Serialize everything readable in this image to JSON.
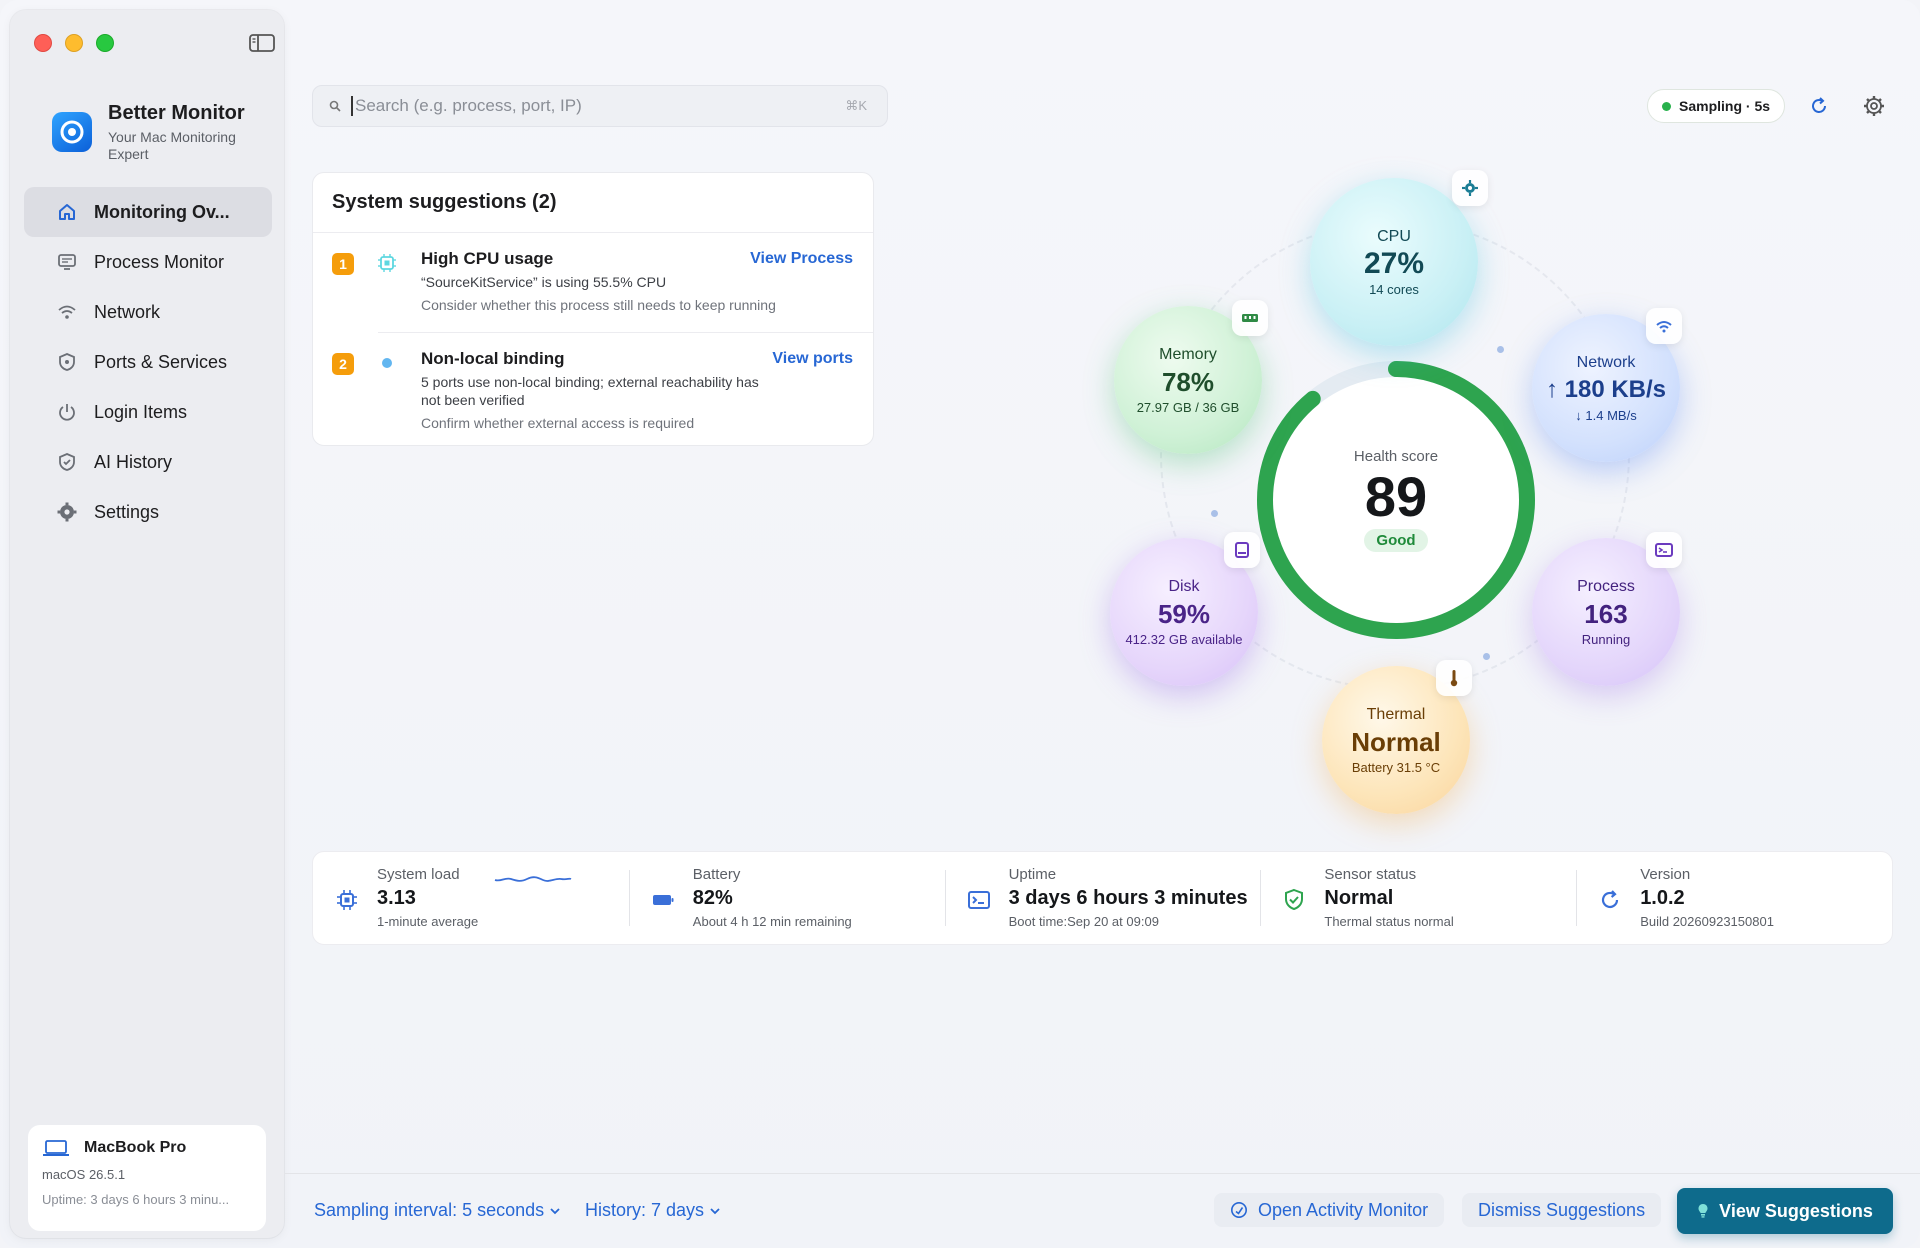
{
  "app": {
    "name": "Better Monitor",
    "tagline": "Your Mac Monitoring Expert"
  },
  "sidebar": {
    "items": [
      {
        "label": "Monitoring Ov...",
        "icon": "home-icon",
        "active": true
      },
      {
        "label": "Process Monitor",
        "icon": "monitor-icon"
      },
      {
        "label": "Network",
        "icon": "wifi-icon"
      },
      {
        "label": "Ports & Services",
        "icon": "shield-icon"
      },
      {
        "label": "Login Items",
        "icon": "power-icon"
      },
      {
        "label": "AI History",
        "icon": "shield-check-icon"
      },
      {
        "label": "Settings",
        "icon": "gear-icon"
      }
    ],
    "device": {
      "name": "MacBook Pro",
      "os": "macOS 26.5.1",
      "uptime": "Uptime: 3 days 6 hours 3 minu..."
    }
  },
  "search": {
    "placeholder": "Search (e.g. process, port, IP)",
    "shortcut": "⌘K"
  },
  "header": {
    "sampling": "Sampling · 5s"
  },
  "suggestions": {
    "title": "System suggestions (2)",
    "items": [
      {
        "num": "1",
        "title": "High CPU usage",
        "desc": "“SourceKitService” is using 55.5% CPU",
        "hint": "Consider whether this process still needs to keep running",
        "action": "View Process"
      },
      {
        "num": "2",
        "title": "Non-local binding",
        "desc": "5 ports use non-local binding; external reachability has not been verified",
        "hint": "Confirm whether external access is required",
        "action": "View ports"
      }
    ]
  },
  "metrics": {
    "cpu": {
      "label": "CPU",
      "value": "27%",
      "sub": "14 cores"
    },
    "memory": {
      "label": "Memory",
      "value": "78%",
      "sub": "27.97 GB / 36 GB"
    },
    "network": {
      "label": "Network",
      "value": "↑ 180 KB/s",
      "sub": "↓ 1.4 MB/s"
    },
    "disk": {
      "label": "Disk",
      "value": "59%",
      "sub": "412.32 GB available"
    },
    "process": {
      "label": "Process",
      "value": "163",
      "sub": "Running"
    },
    "thermal": {
      "label": "Thermal",
      "value": "Normal",
      "sub": "Battery 31.5 °C"
    },
    "health": {
      "label": "Health score",
      "score": "89",
      "status": "Good",
      "fraction": 0.89
    }
  },
  "stats": [
    {
      "label": "System load",
      "value": "3.13",
      "sub": "1-minute average",
      "icon": "cpu-icon"
    },
    {
      "label": "Battery",
      "value": "82%",
      "sub": "About 4 h 12 min remaining",
      "icon": "battery-icon"
    },
    {
      "label": "Uptime",
      "value": "3 days 6 hours 3 minutes",
      "sub": "Boot time:Sep 20 at 09:09",
      "icon": "terminal-icon"
    },
    {
      "label": "Sensor status",
      "value": "Normal",
      "sub": "Thermal status normal",
      "icon": "shield-check-icon"
    },
    {
      "label": "Version",
      "value": "1.0.2",
      "sub": "Build 20260923150801",
      "icon": "refresh-icon"
    }
  ],
  "footer": {
    "sampling_interval": "Sampling interval: 5 seconds",
    "history": "History: 7 days",
    "open_activity": "Open Activity Monitor",
    "dismiss": "Dismiss Suggestions",
    "view_suggestions": "View Suggestions"
  },
  "colors": {
    "accent": "#2767d4",
    "primary_button": "#0e6b8c",
    "health_green": "#2ea44f"
  }
}
